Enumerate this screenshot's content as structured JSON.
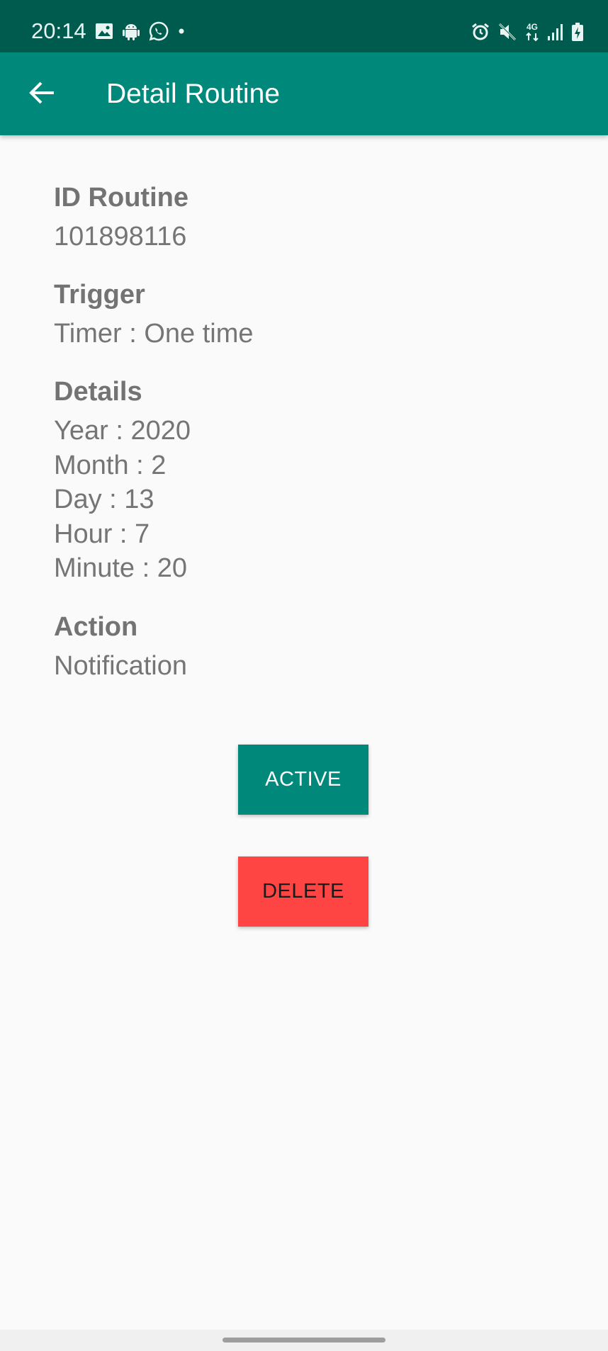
{
  "status_bar": {
    "time": "20:14",
    "network_label": "4G",
    "icons_left": [
      "image-icon",
      "android-icon",
      "whatsapp-icon",
      "dot-icon"
    ],
    "icons_right": [
      "alarm-icon",
      "mute-icon",
      "network-4g-icon",
      "signal-icon",
      "battery-charging-icon"
    ]
  },
  "app_bar": {
    "title": "Detail Routine",
    "back_icon": "arrow-back-icon"
  },
  "routine": {
    "id_label": "ID Routine",
    "id_value": "101898116",
    "trigger_label": "Trigger",
    "trigger_value": "Timer : One time",
    "details_label": "Details",
    "details": [
      "Year : 2020",
      "Month : 2",
      "Day : 13",
      "Hour : 7",
      "Minute : 20"
    ],
    "action_label": "Action",
    "action_value": "Notification"
  },
  "buttons": {
    "active_label": "ACTIVE",
    "delete_label": "DELETE"
  },
  "colors": {
    "status_bar": "#005B4F",
    "primary": "#00897B",
    "delete": "#FF4444",
    "background": "#FAFAFA",
    "text": "#757575"
  }
}
